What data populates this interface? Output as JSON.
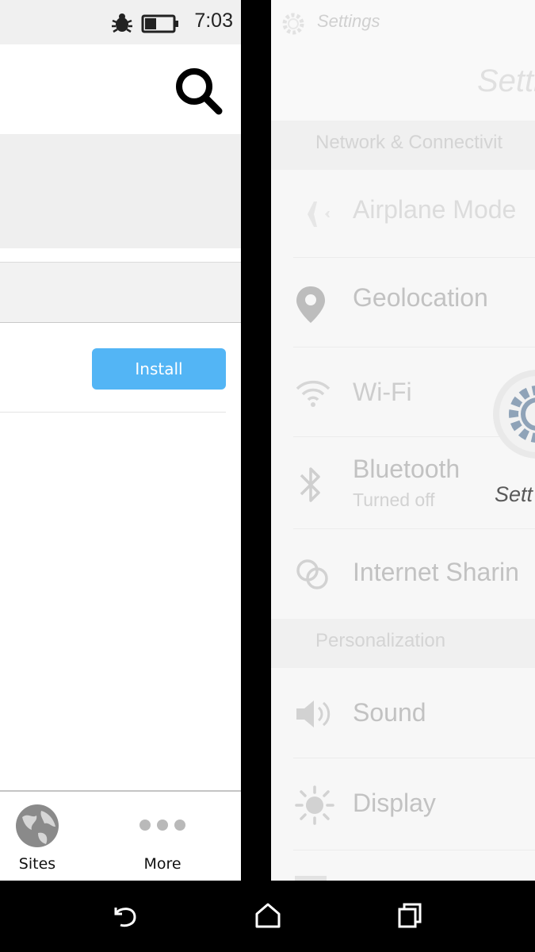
{
  "statusbar": {
    "time": "7:03",
    "icons": [
      "bug-icon",
      "battery-icon"
    ]
  },
  "left_app": {
    "header_icon": "search-icon",
    "install_label": "Install",
    "bottom_nav": [
      {
        "label": "Sites",
        "icon": "globe-icon"
      },
      {
        "label": "More",
        "icon": "more-dots-icon"
      }
    ]
  },
  "settings_card": {
    "window_title": "Settings",
    "header_title": "Setti",
    "sections": [
      {
        "header": "Network & Connectivit"
      },
      {
        "header": "Personalization"
      }
    ],
    "rows": [
      {
        "label": "Airplane Mode",
        "icon": "airplane-icon"
      },
      {
        "label": "Geolocation",
        "icon": "location-pin-icon"
      },
      {
        "label": "Wi-Fi",
        "icon": "wifi-icon"
      },
      {
        "label": "Bluetooth",
        "sublabel": "Turned off",
        "icon": "bluetooth-icon"
      },
      {
        "label": "Internet Sharin",
        "icon": "internet-sharing-icon"
      },
      {
        "label": "Sound",
        "icon": "speaker-icon"
      },
      {
        "label": "Display",
        "icon": "brightness-icon"
      }
    ],
    "app_tile_label": "Sett"
  },
  "system_nav": {
    "buttons": [
      "back-icon",
      "home-icon",
      "recents-icon"
    ]
  },
  "colors": {
    "install_button": "#53b5f5",
    "divider_black": "#000000"
  }
}
